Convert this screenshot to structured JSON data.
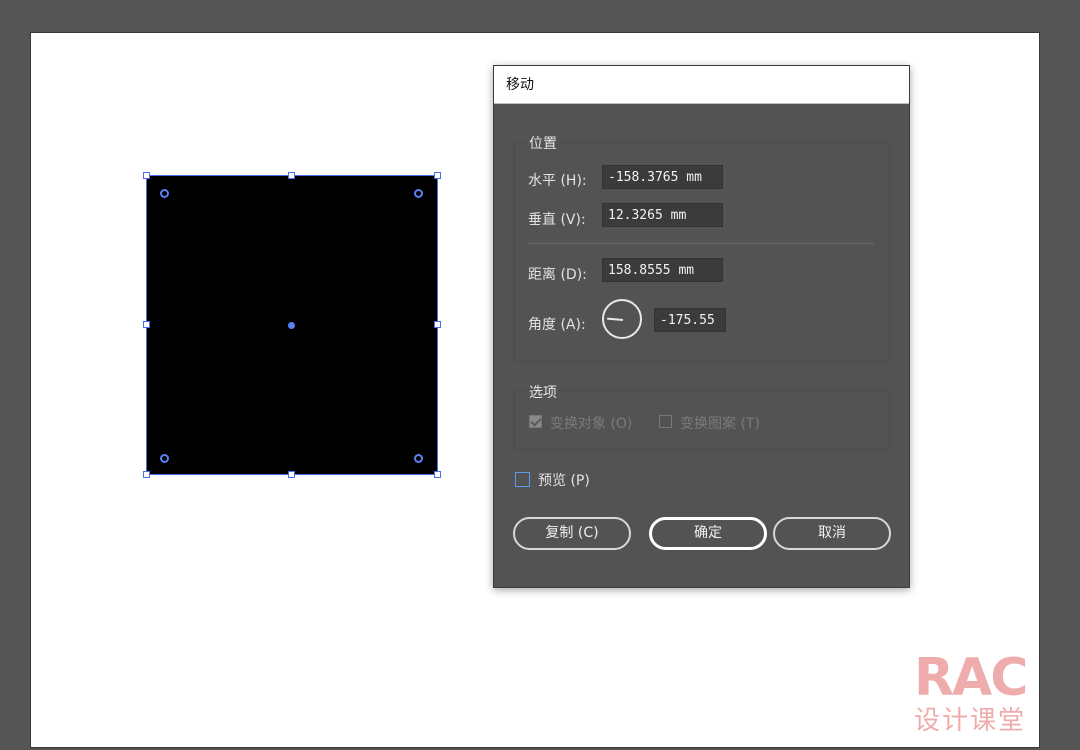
{
  "dialog": {
    "title": "移动",
    "position_group": {
      "title": "位置",
      "horizontal_label": "水平 (H):",
      "horizontal_value": "-158.3765 mm",
      "vertical_label": "垂直 (V):",
      "vertical_value": "12.3265 mm",
      "distance_label": "距离 (D):",
      "distance_value": "158.8555 mm",
      "angle_label": "角度 (A):",
      "angle_value": "-175.55"
    },
    "options_group": {
      "title": "选项",
      "transform_objects_label": "变换对象 (O)",
      "transform_objects_checked": true,
      "transform_patterns_label": "变换图案 (T)",
      "transform_patterns_checked": false
    },
    "preview_label": "预览 (P)",
    "preview_checked": false,
    "buttons": {
      "copy": "复制 (C)",
      "ok": "确定",
      "cancel": "取消"
    }
  },
  "watermark": {
    "logo": "RAC",
    "text": "设计课堂"
  },
  "colors": {
    "workspace": "#555555",
    "artboard": "#ffffff",
    "selection": "#4a6fe8",
    "dialog_bg": "#535353",
    "field_bg": "#3b3b3b"
  }
}
